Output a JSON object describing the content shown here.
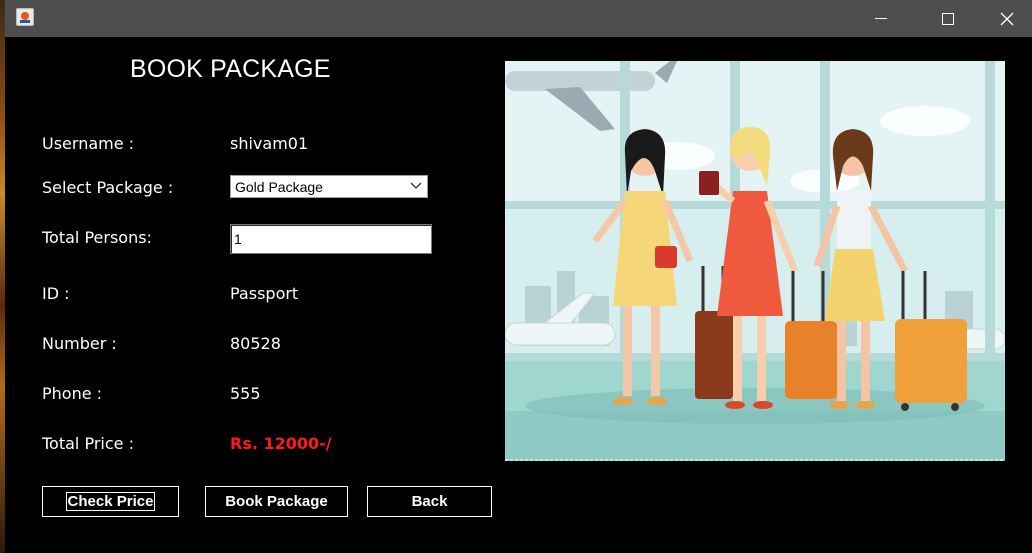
{
  "window": {
    "title": "",
    "controls": [
      "minimize",
      "maximize",
      "close"
    ]
  },
  "form": {
    "heading": "BOOK PACKAGE",
    "username": {
      "label": "Username :",
      "value": "shivam01"
    },
    "package": {
      "label": "Select Package :",
      "selected": "Gold Package"
    },
    "persons": {
      "label": "Total Persons:",
      "value": "1"
    },
    "id": {
      "label": "ID :",
      "value": "Passport"
    },
    "number": {
      "label": "Number :",
      "value": "80528"
    },
    "phone": {
      "label": "Phone :",
      "value": "555"
    },
    "price": {
      "label": "Total Price :",
      "value": "Rs. 12000-/"
    }
  },
  "buttons": {
    "check_price": "Check Price",
    "book_package": "Book Package",
    "back": "Back"
  },
  "colors": {
    "background": "#000000",
    "titlebar": "#4e4e4e",
    "price": "#ff1a1a"
  },
  "illustration": {
    "subject": "three women with suitcases at airport terminal"
  }
}
